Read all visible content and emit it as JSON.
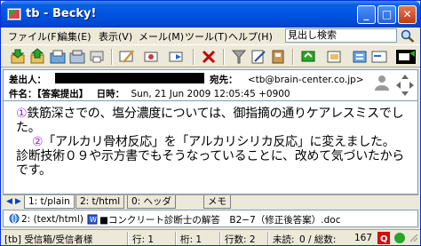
{
  "window": {
    "title": "tb - Becky!",
    "minimize_label": "_",
    "maximize_label": "□",
    "close_label": "✕"
  },
  "menu": {
    "items": [
      "ファイル(F)",
      "編集(E)",
      "表示(V)",
      "メール(M)",
      "ツール(T)",
      "ヘルプ(H)"
    ],
    "search_placeholder": "見出し検索"
  },
  "header": {
    "from_label": "差出人：",
    "to_label": "宛先：",
    "to_value": "<tb@brain-center.co.jp>",
    "subject_label": "件名：",
    "subject_value": "【答案提出】",
    "date_label": "日時：",
    "date_value": "Sun, 21 Jun 2009 12:05:45 +0900"
  },
  "body": {
    "marker1": "①",
    "line1": "鉄筋深さでの、塩分濃度については、御指摘の通りケアレスミスでした。",
    "marker2": "②",
    "line2": "「アルカリ骨材反応」を「アルカリシリカ反応」に変えました。診断技術０９や示方書でもそうなっていることに、改めて気づいたからです。"
  },
  "tabs": {
    "items": [
      "1: t/plain",
      "2: t/html",
      "0: ヘッダ",
      "メモ"
    ]
  },
  "attachments": {
    "items": [
      "2: (text/html)",
      "■コンクリート診断士の解答　B2−7（修正後答案）.doc"
    ]
  },
  "status": {
    "folder": "[tb] 受信箱/受信者様",
    "line": "行: 1",
    "col": "桁: 1",
    "rows": "行数: 2",
    "unread": "未読:",
    "counts": "0 / 総数:",
    "total": "167"
  },
  "colors": {
    "titlebar": "#0054e3",
    "circle_marker": "#9a2bd8"
  }
}
